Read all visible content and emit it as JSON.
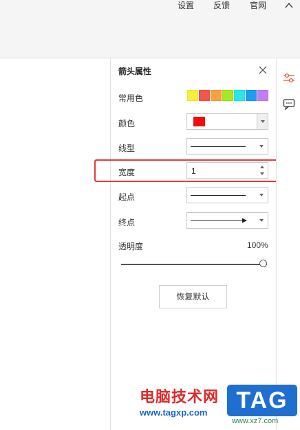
{
  "topbar": {
    "settings": "设置",
    "feedback": "反馈",
    "official_site": "官网"
  },
  "panel": {
    "title": "箭头属性",
    "common_colors_label": "常用色",
    "common_colors": [
      "#f6f03c",
      "#f2574b",
      "#f7a23c",
      "#a8e81e",
      "#28e8e8",
      "#1a9df2",
      "#c07ef2"
    ],
    "color_label": "颜色",
    "color_value": "#ef0d0d",
    "line_type_label": "线型",
    "width_label": "宽度",
    "width_value": "1",
    "start_label": "起点",
    "end_label": "终点",
    "opacity_label": "透明度",
    "opacity_value": "100%",
    "opacity_fraction": 1.0,
    "reset_button": "恢复默认"
  },
  "right_toolbar": {
    "icons": [
      "sliders-icon",
      "chat-icon"
    ]
  },
  "watermark": {
    "brand_cn": "电脑技术网",
    "url": "www.tagxp.com",
    "tag": "TAG",
    "url2": "www.xz7.com"
  }
}
